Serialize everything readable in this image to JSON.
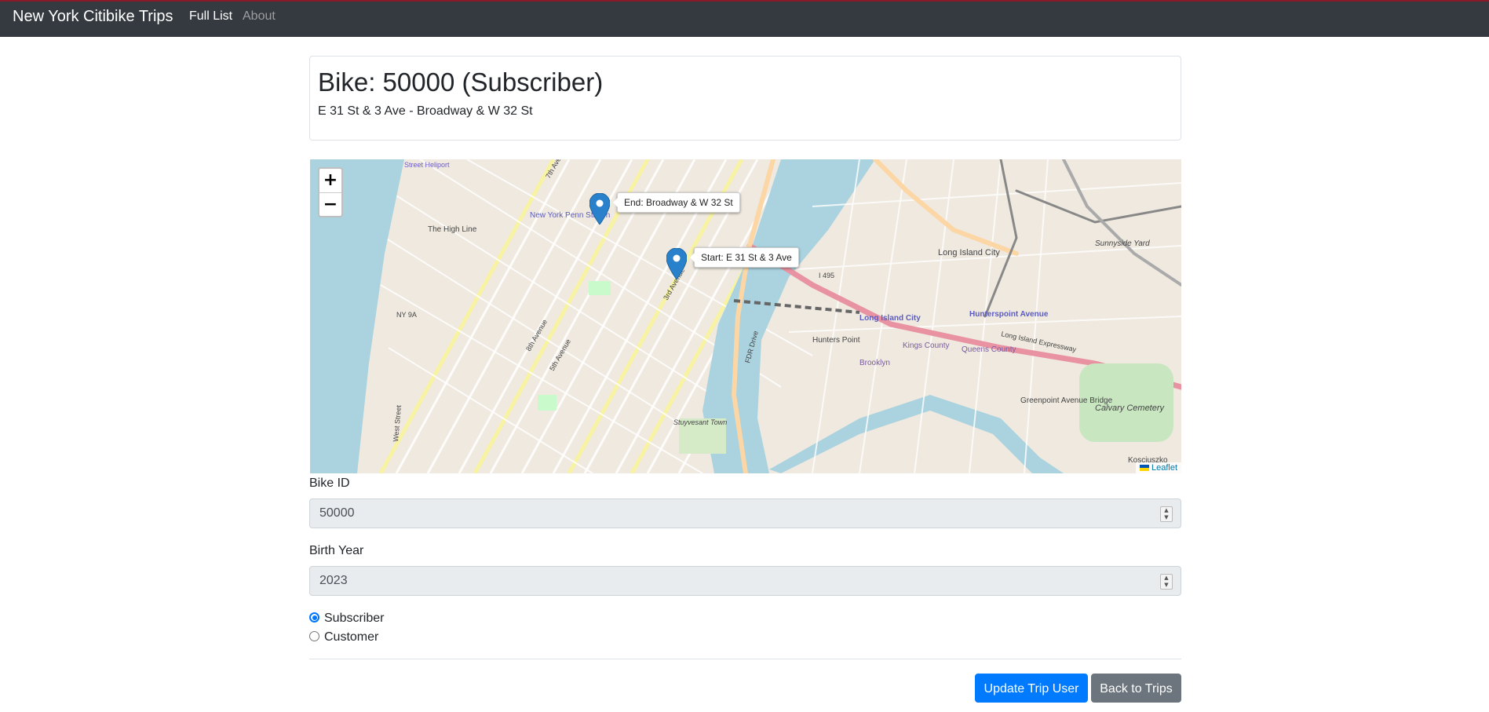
{
  "navbar": {
    "brand": "New York Citibike Trips",
    "links": [
      {
        "label": "Full List",
        "active": true
      },
      {
        "label": "About",
        "active": false
      }
    ]
  },
  "trip": {
    "title": "Bike: 50000 (Subscriber)",
    "route": "E 31 St & 3 Ave - Broadway & W 32 St"
  },
  "map": {
    "zoom_in": "+",
    "zoom_out": "−",
    "markers": [
      {
        "tooltip": "End: Broadway & W 32 St"
      },
      {
        "tooltip": "Start: E 31 St & 3 Ave"
      }
    ],
    "labels": {
      "penn": "New York Penn Station",
      "highline": "The High Line",
      "heliport": "Street Heliport",
      "lic": "Long Island City",
      "hunterspoint": "Hunterspoint Avenue",
      "lic2": "Long Island City",
      "hunterspoint_point": "Hunters Point",
      "greenpoint": "Greenpoint Avenue Bridge",
      "calvary": "Calvary Cemetery",
      "stuyvesant": "Stuyvesant Town",
      "kosciuszko": "Kosciuszko",
      "i495": "I 495",
      "ny9a": "NY 9A",
      "fdr": "FDR Drive",
      "ave3": "3rd Avenue",
      "ave5": "5th Avenue",
      "ave7": "7th Avenue",
      "ave8": "8th Avenue",
      "west_st": "West Street",
      "queens_county": "Queens County",
      "kings_county": "Kings County",
      "brooklyn": "Brooklyn",
      "lie": "Long Island Expressway",
      "sunnyside": "Sunnyside Yard"
    },
    "attribution": "Leaflet",
    "colors": {
      "water": "#aad3df",
      "land": "#f2efe9",
      "park": "#c8facc",
      "marker": "#2a81cb"
    }
  },
  "form": {
    "bike_id_label": "Bike ID",
    "bike_id_value": "50000",
    "birth_year_label": "Birth Year",
    "birth_year_value": "2023",
    "user_types": [
      {
        "label": "Subscriber",
        "checked": true
      },
      {
        "label": "Customer",
        "checked": false
      }
    ],
    "update_button": "Update Trip User",
    "back_button": "Back to Trips"
  }
}
